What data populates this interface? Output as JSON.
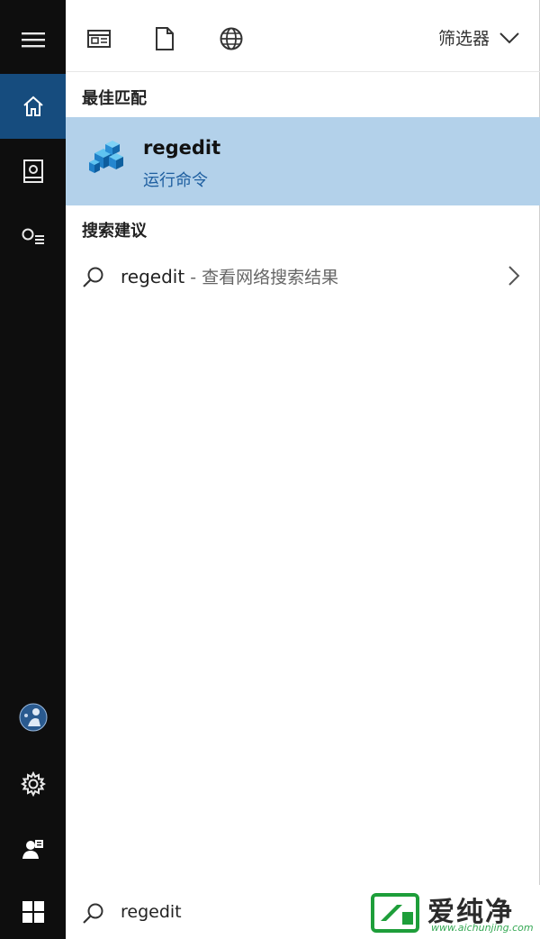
{
  "rail": {
    "items": [
      {
        "icon": "hamburger-menu-icon"
      },
      {
        "icon": "home-icon",
        "active": true
      },
      {
        "icon": "notebook-icon"
      },
      {
        "icon": "feedback-icon"
      }
    ],
    "bottom_items": [
      {
        "icon": "avatar-icon"
      },
      {
        "icon": "gear-icon"
      },
      {
        "icon": "person-icon"
      }
    ]
  },
  "toolbar": {
    "icons": [
      "apps-icon",
      "document-icon",
      "web-globe-icon"
    ],
    "filter_label": "筛选器",
    "filter_icon": "chevron-down-icon"
  },
  "best_match": {
    "section_title": "最佳匹配",
    "title": "regedit",
    "subtitle": "运行命令",
    "icon": "registry-editor-icon",
    "highlight_color": "#b3d1ea"
  },
  "suggestions": {
    "section_title": "搜索建议",
    "items": [
      {
        "query": "regedit",
        "suffix": " - 查看网络搜索结果",
        "icon": "search-icon",
        "arrow_icon": "chevron-right-icon"
      }
    ]
  },
  "taskbar": {
    "start_icon": "windows-logo-icon",
    "search_value": "regedit",
    "search_icon": "search-icon"
  },
  "watermark": {
    "title": "爱纯净",
    "url": "www.aichunjing.com"
  }
}
